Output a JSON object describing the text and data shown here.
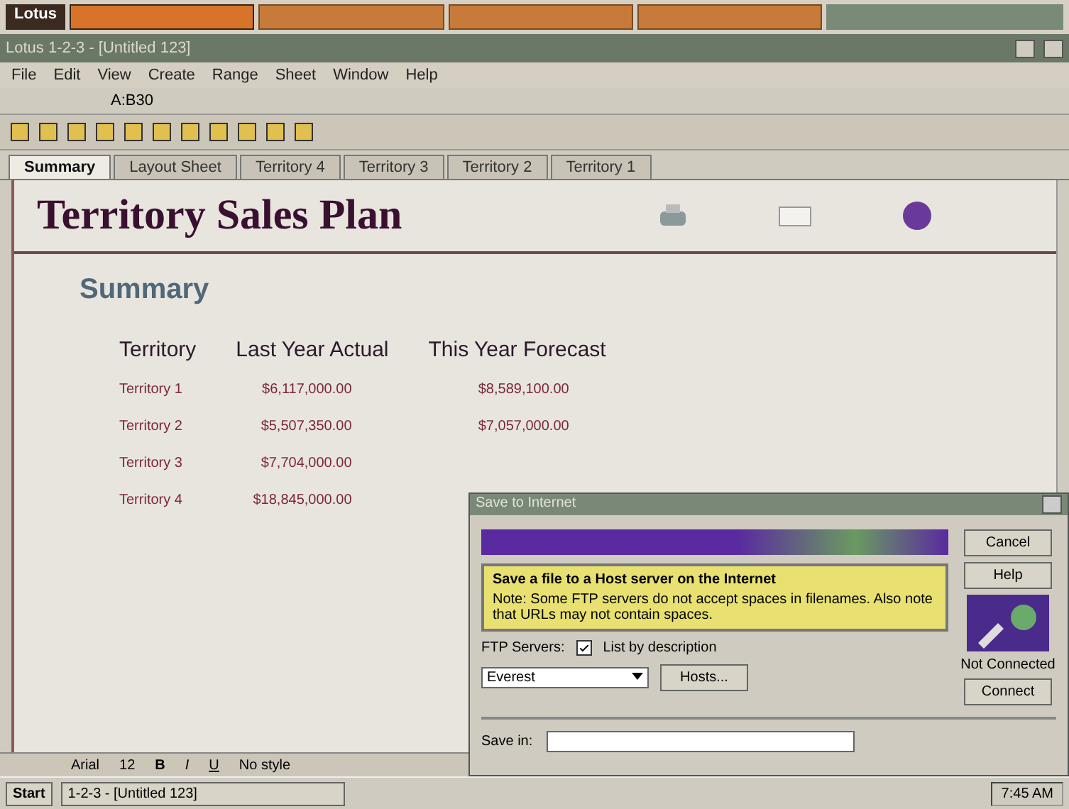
{
  "suite_bar": {
    "logo": "Lotus",
    "drawers": [
      {
        "selected": true
      },
      {
        "selected": false
      },
      {
        "selected": false
      },
      {
        "selected": false
      }
    ]
  },
  "window": {
    "title": "Lotus 1-2-3 - [Untitled 123]"
  },
  "menu": [
    "File",
    "Edit",
    "View",
    "Create",
    "Range",
    "Sheet",
    "Window",
    "Help"
  ],
  "cell_reference": "A:B30",
  "sheet_tabs": [
    {
      "label": "Summary",
      "selected": true
    },
    {
      "label": "Layout Sheet",
      "selected": false
    },
    {
      "label": "Territory 4",
      "selected": false
    },
    {
      "label": "Territory 3",
      "selected": false
    },
    {
      "label": "Territory 2",
      "selected": false
    },
    {
      "label": "Territory 1",
      "selected": false
    }
  ],
  "sheet": {
    "title": "Territory Sales Plan",
    "heading": "Summary",
    "columns": [
      "Territory",
      "Last Year Actual",
      "This Year Forecast"
    ],
    "rows": [
      [
        "Territory 1",
        "$6,117,000.00",
        "$8,589,100.00"
      ],
      [
        "Territory 2",
        "$5,507,350.00",
        "$7,057,000.00"
      ],
      [
        "Territory 3",
        "$7,704,000.00"
      ],
      [
        "Territory 4",
        "$18,845,000.00"
      ]
    ]
  },
  "dialog": {
    "title": "Save to Internet",
    "banner_title": "Save a file to a Host server on the Internet",
    "banner_note": "Note: Some FTP servers do not accept spaces in filenames. Also note that URLs may not contain spaces.",
    "ftp_label": "FTP Servers:",
    "list_by_description": {
      "label": "List by description",
      "checked": true
    },
    "server": "Everest",
    "hosts_button": "Hosts...",
    "status": "Not Connected",
    "buttons": [
      "Cancel",
      "Help"
    ],
    "connect_button": "Connect",
    "save_in_label": "Save in:"
  },
  "status_bar": {
    "font": "Arial",
    "size": "12",
    "bold": "B",
    "italic": "I",
    "underline": "U",
    "style": "No style"
  },
  "taskbar": {
    "start": "Start",
    "tasks": [
      "1-2-3 - [Untitled 123]"
    ],
    "clock": "7:45 AM"
  }
}
